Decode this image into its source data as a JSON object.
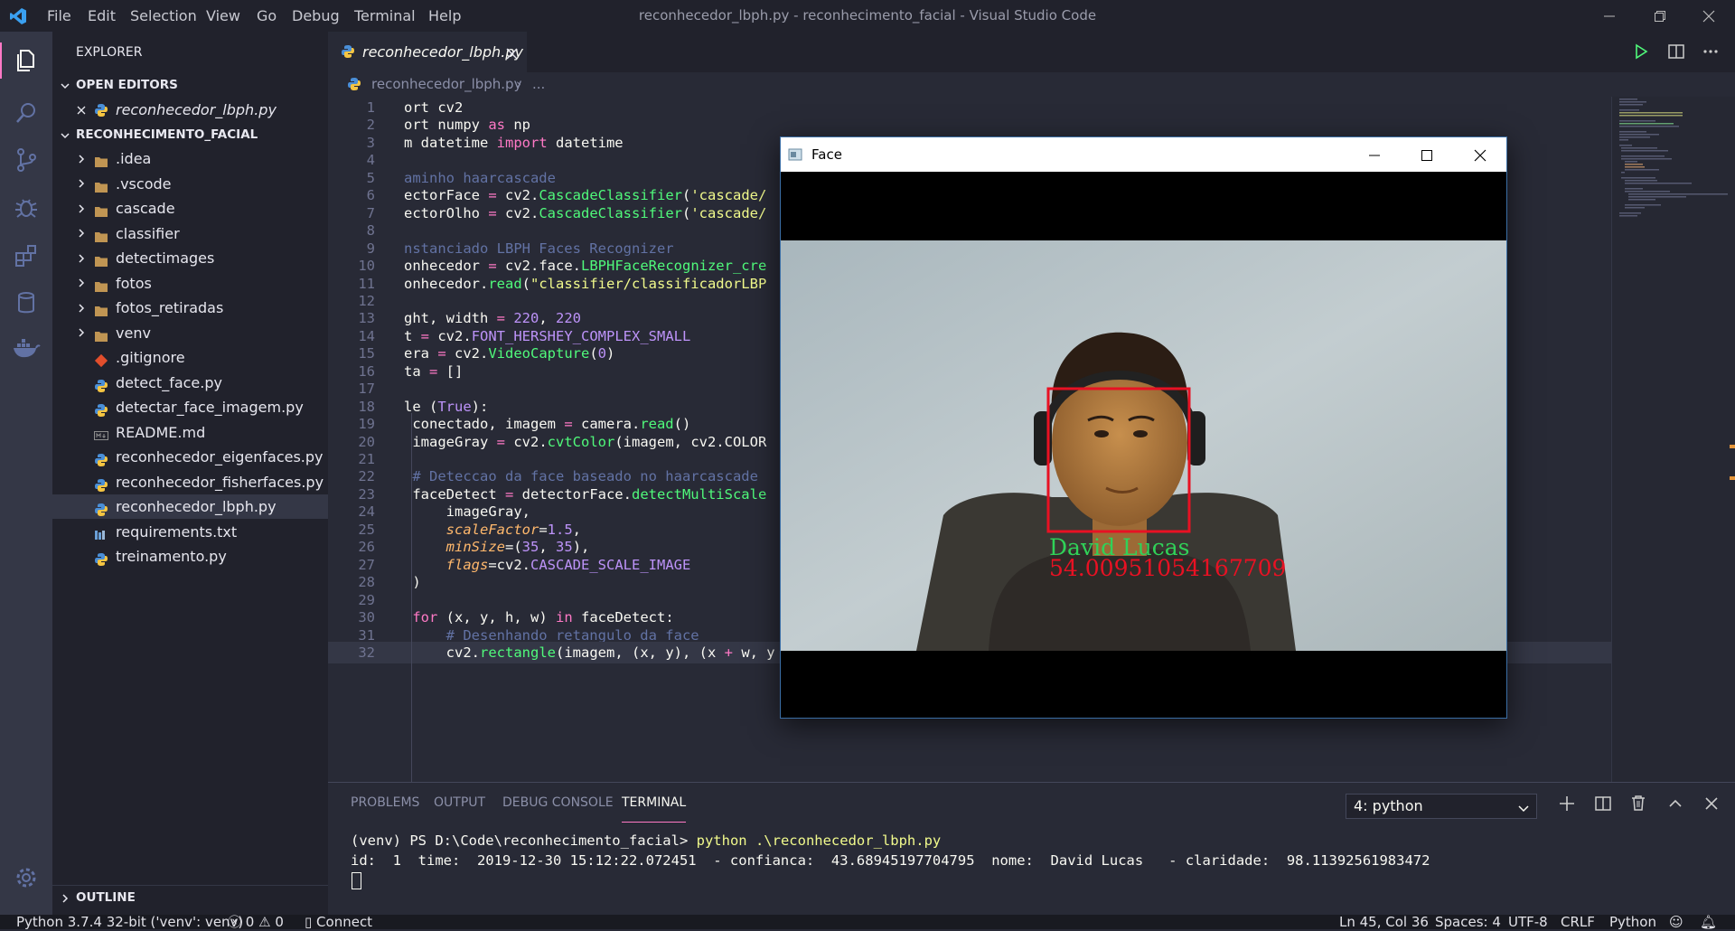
{
  "titlebar": {
    "menu": [
      "File",
      "Edit",
      "Selection",
      "View",
      "Go",
      "Debug",
      "Terminal",
      "Help"
    ],
    "window_title": "reconhecedor_lbph.py - reconhecimento_facial - Visual Studio Code"
  },
  "sidebar": {
    "title": "EXPLORER",
    "open_editors_label": "OPEN EDITORS",
    "open_editor_file": "reconhecedor_lbph.py",
    "project_label": "RECONHECIMENTO_FACIAL",
    "items": [
      {
        "label": ".idea",
        "kind": "folder"
      },
      {
        "label": ".vscode",
        "kind": "folder"
      },
      {
        "label": "cascade",
        "kind": "folder"
      },
      {
        "label": "classifier",
        "kind": "folder"
      },
      {
        "label": "detectimages",
        "kind": "folder"
      },
      {
        "label": "fotos",
        "kind": "folder"
      },
      {
        "label": "fotos_retiradas",
        "kind": "folder"
      },
      {
        "label": "venv",
        "kind": "folder"
      },
      {
        "label": ".gitignore",
        "kind": "git"
      },
      {
        "label": "detect_face.py",
        "kind": "python"
      },
      {
        "label": "detectar_face_imagem.py",
        "kind": "python"
      },
      {
        "label": "README.md",
        "kind": "markdown"
      },
      {
        "label": "reconhecedor_eigenfaces.py",
        "kind": "python"
      },
      {
        "label": "reconhecedor_fisherfaces.py",
        "kind": "python"
      },
      {
        "label": "reconhecedor_lbph.py",
        "kind": "python"
      },
      {
        "label": "requirements.txt",
        "kind": "text"
      },
      {
        "label": "treinamento.py",
        "kind": "python"
      }
    ],
    "outline_label": "OUTLINE"
  },
  "editor": {
    "tab_label": "reconhecedor_lbph.py",
    "breadcrumb_file": "reconhecedor_lbph.py",
    "breadcrumb_more": "...",
    "lines": [
      {
        "n": "1",
        "t": "ort cv2"
      },
      {
        "n": "2",
        "t": "ort numpy as np"
      },
      {
        "n": "3",
        "t": "m datetime import datetime"
      },
      {
        "n": "4",
        "t": ""
      },
      {
        "n": "5",
        "t": "aminho haarcascade"
      },
      {
        "n": "6",
        "t": "ectorFace = cv2.CascadeClassifier('cascade/"
      },
      {
        "n": "7",
        "t": "ectorOlho = cv2.CascadeClassifier('cascade/"
      },
      {
        "n": "8",
        "t": ""
      },
      {
        "n": "9",
        "t": "nstanciado LBPH Faces Recognizer"
      },
      {
        "n": "10",
        "t": "onhecedor = cv2.face.LBPHFaceRecognizer_cre"
      },
      {
        "n": "11",
        "t": "onhecedor.read(\"classifier/classificadorLBP"
      },
      {
        "n": "12",
        "t": ""
      },
      {
        "n": "13",
        "t": "ght, width = 220, 220"
      },
      {
        "n": "14",
        "t": "t = cv2.FONT_HERSHEY_COMPLEX_SMALL"
      },
      {
        "n": "15",
        "t": "era = cv2.VideoCapture(0)"
      },
      {
        "n": "16",
        "t": "ta = []"
      },
      {
        "n": "17",
        "t": ""
      },
      {
        "n": "18",
        "t": "le (True):"
      },
      {
        "n": "19",
        "t": " conectado, imagem = camera.read()"
      },
      {
        "n": "20",
        "t": " imageGray = cv2.cvtColor(imagem, cv2.COLOR"
      },
      {
        "n": "21",
        "t": ""
      },
      {
        "n": "22",
        "t": " # Deteccao da face baseado no haarcascade"
      },
      {
        "n": "23",
        "t": " faceDetect = detectorFace.detectMultiScale"
      },
      {
        "n": "24",
        "t": "     imageGray,"
      },
      {
        "n": "25",
        "t": "     scaleFactor=1.5,"
      },
      {
        "n": "26",
        "t": "     minSize=(35, 35),"
      },
      {
        "n": "27",
        "t": "     flags=cv2.CASCADE_SCALE_IMAGE"
      },
      {
        "n": "28",
        "t": " )"
      },
      {
        "n": "29",
        "t": ""
      },
      {
        "n": "30",
        "t": " for (x, y, h, w) in faceDetect:"
      },
      {
        "n": "31",
        "t": "     # Desenhando retangulo da face"
      },
      {
        "n": "32",
        "t": "     cv2.rectangle(imagem, (x, y), (x + w, y + h), (0, 0, 255), 2)"
      }
    ]
  },
  "face_window": {
    "title": "Face",
    "overlay_name": "David Lucas",
    "overlay_score": "54.00951054167709"
  },
  "panel": {
    "tabs": [
      "PROBLEMS",
      "OUTPUT",
      "DEBUG CONSOLE",
      "TERMINAL"
    ],
    "active_tab": "TERMINAL",
    "terminal_select": "4: python",
    "prompt": "(venv) PS D:\\Code\\reconhecimento_facial>",
    "command": "python .\\reconhecedor_lbph.py",
    "output": "id:  1  time:  2019-12-30 15:12:22.072451  - confianca:  43.68945197704795  nome:  David Lucas   - claridade:  98.11392561983472"
  },
  "statusbar": {
    "interpreter": "Python 3.7.4 32-bit ('venv': venv)",
    "errors": "0",
    "warnings": "0",
    "connect": "Connect",
    "cursor": "Ln 45, Col 36",
    "spaces": "Spaces: 4",
    "encoding": "UTF-8",
    "eol": "CRLF",
    "language": "Python"
  },
  "colors": {
    "accent_face_box": "#e81123",
    "overlay_name": "#30d158",
    "overlay_score": "#e81123"
  }
}
